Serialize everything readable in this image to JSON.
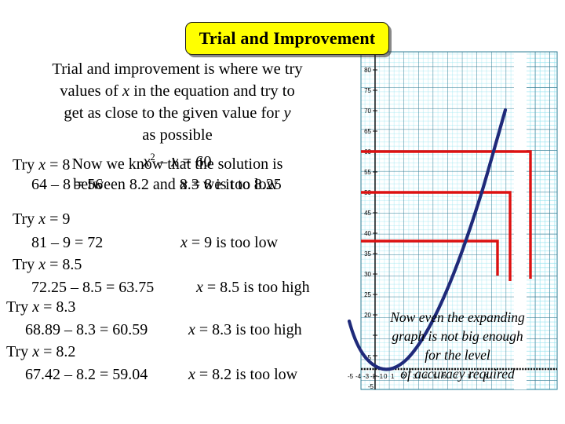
{
  "title": {
    "label": "Trial and Improvement",
    "bg_color": "#ffff00",
    "text_color": "#000000"
  },
  "intro": {
    "line1": "Trial and improvement is where we try",
    "line2_a": "values of ",
    "line2_x": "x",
    "line2_b": " in the equation and try to",
    "line3_a": "get as close to the given value for ",
    "line3_y": "y",
    "line4": "as possible"
  },
  "equation": {
    "lhs_base": "x",
    "lhs_power": "2",
    "minus_x": " – x",
    "rhs": " = 60",
    "full": "x² – x = 60"
  },
  "trials": [
    {
      "try_label": "Try ",
      "try_var": "x",
      "try_value": " = 8",
      "calc": "64 – 8 = 56",
      "verdict_var": "x",
      "verdict": " = 8 is too low"
    },
    {
      "try_label": "Try ",
      "try_var": "x",
      "try_value": " = 9",
      "calc": "81 – 9 = 72",
      "verdict_var": "x",
      "verdict": " = 9 is too low"
    },
    {
      "try_label": "Try ",
      "try_var": "x",
      "try_value": " = 8.5",
      "calc": "72.25 – 8.5 = 63.75",
      "verdict_var": "x",
      "verdict": " = 8.5 is too high"
    },
    {
      "try_label": "Try ",
      "try_var": "x",
      "try_value": " = 8.3",
      "calc": "68.89 – 8.3 = 60.59",
      "verdict_var": "x",
      "verdict": " = 8.3 is too high"
    },
    {
      "try_label": "Try ",
      "try_var": "x",
      "try_value": " = 8.2",
      "calc": "67.42 – 8.2 = 59.04",
      "verdict_var": "x",
      "verdict": " = 8.2 is too low"
    }
  ],
  "conclusion": {
    "line1": "Now we know that the solution is",
    "line2_a": "between 8.2 and 8.3 ",
    "line2_b": "we it to 8.25"
  },
  "graph_note": {
    "line1": "Now even the expanding",
    "line2": "graph is not big enough",
    "line3": "for the level",
    "line4": "of accuracy required"
  },
  "chart_data": {
    "type": "line",
    "title": "",
    "xlabel": "",
    "ylabel": "",
    "xlim": [
      -5.5,
      9.5
    ],
    "ylim": [
      -6,
      84
    ],
    "grid": true,
    "x_ticks": [
      -5,
      -4,
      -3,
      -2,
      -1,
      0,
      1,
      2,
      3,
      4,
      5,
      6,
      7,
      8,
      9
    ],
    "x_tick_labels": [
      "-5",
      "-4",
      "-3",
      "-2",
      "-1",
      "0",
      "1",
      "2",
      "3",
      "4",
      "5",
      "6",
      "7",
      "8",
      "9"
    ],
    "y_ticks": [
      -5,
      5,
      20,
      25,
      30,
      35,
      40,
      45,
      50,
      55,
      60,
      65,
      70,
      75,
      80
    ],
    "y_tick_labels": [
      "-5",
      "5",
      "20",
      "25",
      "30",
      "35",
      "40",
      "45",
      "50",
      "55",
      "60",
      "65",
      "70",
      "75",
      "80"
    ],
    "series": [
      {
        "name": "y = x² – x",
        "color": "#1f2a7a",
        "type": "curve",
        "x": [
          -3,
          -2.5,
          -2,
          -1.5,
          -1,
          -0.5,
          0,
          0.5,
          1,
          1.5,
          2,
          2.5,
          3,
          3.5,
          4,
          4.5,
          5,
          5.5,
          6,
          6.5,
          7,
          7.5,
          8,
          8.5,
          8.9
        ],
        "y": [
          12,
          8.75,
          6,
          3.75,
          2,
          0.75,
          0,
          -0.25,
          0,
          0.75,
          2,
          3.75,
          6,
          8.75,
          12,
          15.75,
          20,
          24.75,
          30,
          35.75,
          42,
          48.75,
          56,
          63.75,
          70.31
        ]
      },
      {
        "name": "guide-60",
        "color": "#dd1111",
        "type": "guide",
        "y_level": 60,
        "x_drop": 8.25
      },
      {
        "name": "guide-50",
        "color": "#dd1111",
        "type": "guide",
        "y_level": 50,
        "x_drop": 7.6
      },
      {
        "name": "guide-38",
        "color": "#dd1111",
        "type": "guide",
        "y_level": 38,
        "x_drop": 7.0
      }
    ]
  }
}
